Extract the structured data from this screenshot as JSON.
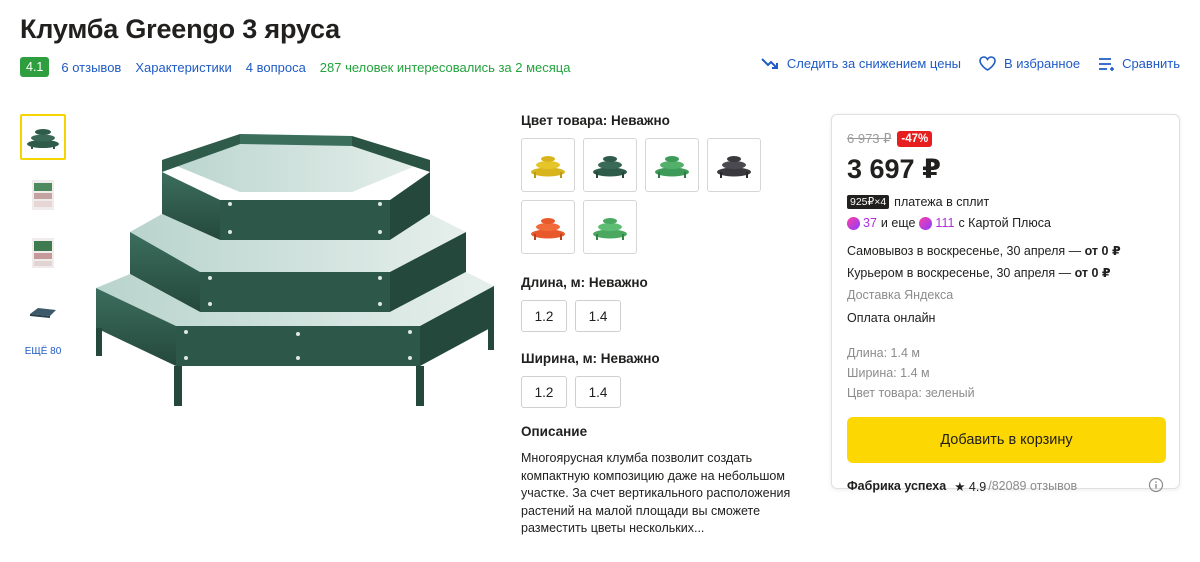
{
  "title": "Клумба Greengo 3 яруса",
  "meta": {
    "rating": "4.1",
    "reviews": "6 отзывов",
    "specs": "Характеристики",
    "questions": "4 вопроса",
    "interest": "287 человек интересовались за 2 месяца"
  },
  "actions": {
    "price_watch": "Следить за снижением цены",
    "favorite": "В избранное",
    "compare": "Сравнить"
  },
  "gallery": {
    "more": "ЕЩЁ 80"
  },
  "options": {
    "color_label": "Цвет товара: Неважно",
    "length_label": "Длина, м: Неважно",
    "length_values": [
      "1.2",
      "1.4"
    ],
    "width_label": "Ширина, м: Неважно",
    "width_values": [
      "1.2",
      "1.4"
    ]
  },
  "description": {
    "title": "Описание",
    "text": "Многоярусная клумба позволит создать компактную композицию даже на небольшом участке. За счет вертикального расположения растений на малой площади вы сможете разместить цветы нескольких..."
  },
  "card": {
    "old_price": "6 973 ₽",
    "discount": "-47%",
    "price": "3 697 ₽",
    "split_badge": "925₽×4",
    "split_text": "платежа в сплит",
    "plus_a": "37",
    "plus_mid": "и еще",
    "plus_b": "111",
    "plus_tail": "с Картой Плюса",
    "pickup_text": "Самовывоз в воскресенье, 30 апреля — ",
    "pickup_price": "от 0 ₽",
    "courier_text": "Курьером в воскресенье, 30 апреля — ",
    "courier_price": "от 0 ₽",
    "delivery_service": "Доставка Яндекса",
    "payment": "Оплата онлайн",
    "spec_length": "Длина:  1.4 м",
    "spec_width": "Ширина:  1.4 м",
    "spec_color": "Цвет товара:  зеленый",
    "cart_button": "Добавить в корзину",
    "seller_name": "Фабрика успеха",
    "seller_rating": "★ 4.9",
    "seller_reviews": "/82089 отзывов"
  },
  "colors": {
    "accent_yellow": "#fdd701",
    "link_blue": "#1f5bc4",
    "rating_green": "#2e9e3f",
    "discount_red": "#e61e1e",
    "product_green": "#2f5b4a"
  }
}
